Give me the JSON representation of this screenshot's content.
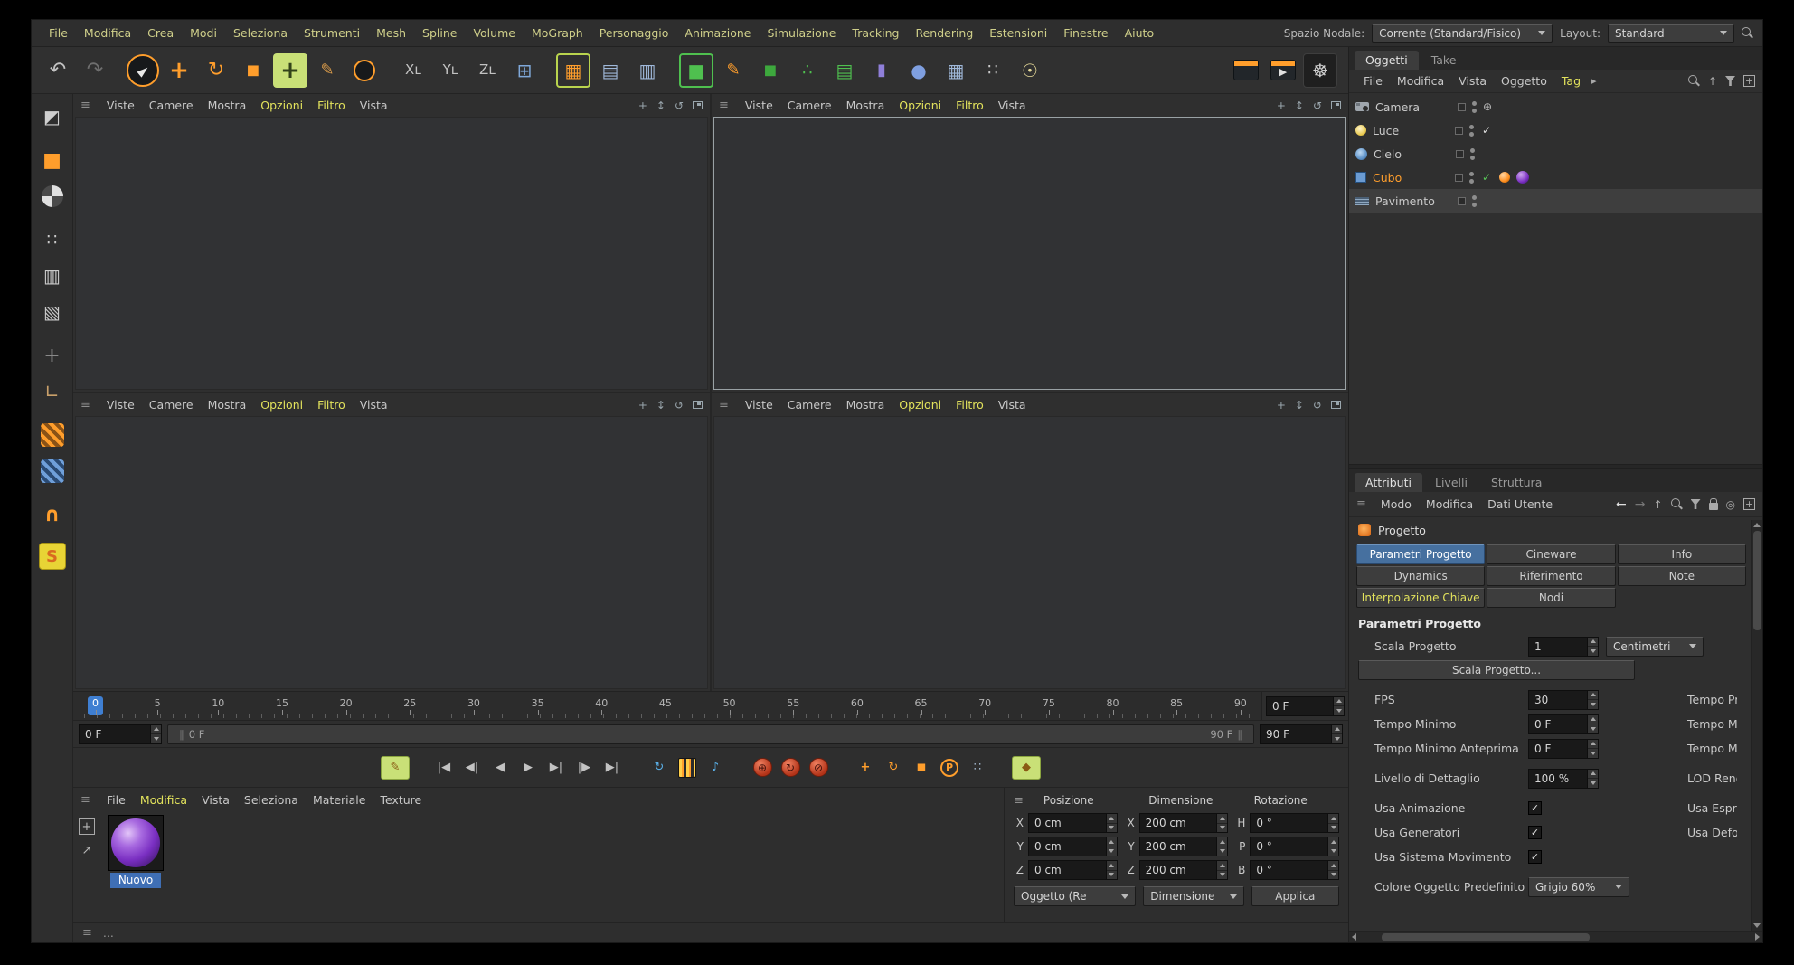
{
  "colors": {
    "accent_orange": "#ff9e2c",
    "accent_yellow": "#e2e25c",
    "selection_blue": "#46709f",
    "tool_highlight_green": "#c9e077",
    "timeline_marker_blue": "#3f7fd2",
    "material_purple": "#7a2fc2"
  },
  "icons": {
    "grip": "≡",
    "chevron_right": "▸",
    "check": "✓",
    "pan": "+",
    "zoom": "↕",
    "orbit": "↺",
    "arrow_left": "←",
    "arrow_right": "→",
    "arrow_up": "↑",
    "target": "◎",
    "plus": "+",
    "arrow_up_right": "↗",
    "range_cap": "∥"
  },
  "menubar": {
    "items": [
      {
        "label": "File"
      },
      {
        "label": "Modifica"
      },
      {
        "label": "Crea"
      },
      {
        "label": "Modi"
      },
      {
        "label": "Seleziona"
      },
      {
        "label": "Strumenti"
      },
      {
        "label": "Mesh"
      },
      {
        "label": "Spline"
      },
      {
        "label": "Volume"
      },
      {
        "label": "MoGraph"
      },
      {
        "label": "Personaggio"
      },
      {
        "label": "Animazione"
      },
      {
        "label": "Simulazione"
      },
      {
        "label": "Tracking"
      },
      {
        "label": "Rendering"
      },
      {
        "label": "Estensioni"
      },
      {
        "label": "Finestre"
      },
      {
        "label": "Aiuto"
      }
    ],
    "nodal_label": "Spazio Nodale:",
    "nodal_value": "Corrente (Standard/Fisico)",
    "layout_label": "Layout:",
    "layout_value": "Standard"
  },
  "toolbar": {
    "g1": [
      {
        "name": "undo-icon",
        "glyph": "↶",
        "fg": "#c2c2c2",
        "cls": "s22"
      },
      {
        "name": "redo-icon",
        "glyph": "↷",
        "fg": "#6e6e6e",
        "cls": "s22"
      }
    ],
    "g2": [
      {
        "name": "live-selection-tool",
        "glyph": "►",
        "fg": "#e8e8e8",
        "cls": "ring"
      },
      {
        "name": "move-tool",
        "glyph": "+",
        "fg": "#ff9e2c",
        "cls": "s26 bold"
      },
      {
        "name": "rotate-tool",
        "glyph": "↻",
        "fg": "#ff9e2c",
        "cls": "s22"
      },
      {
        "name": "scale-tool",
        "glyph": "◼",
        "fg": "#ff9e2c",
        "cls": "s18"
      },
      {
        "name": "omni-move-tool",
        "glyph": "+",
        "fg": "#33431a",
        "cls": "hl s26 bold"
      },
      {
        "name": "brush-tool",
        "glyph": "✎",
        "fg": "#d89a4a",
        "cls": "s18"
      },
      {
        "name": "circle-selection-tool",
        "glyph": "",
        "cls": "ring2"
      }
    ],
    "g3": [
      {
        "name": "x-axis-lock",
        "glyph": "Xʟ",
        "fg": "#c2c2c2",
        "cls": "s15"
      },
      {
        "name": "y-axis-lock",
        "glyph": "Yʟ",
        "fg": "#c2c2c2",
        "cls": "s15"
      },
      {
        "name": "z-axis-lock",
        "glyph": "Zʟ",
        "fg": "#c2c2c2",
        "cls": "s15"
      },
      {
        "name": "coordinate-system-toggle",
        "glyph": "⊞",
        "fg": "#7fa8d9",
        "cls": "s20"
      }
    ],
    "g4": [
      {
        "name": "render-view-button",
        "glyph": "▦",
        "fg": "#ff9e2c",
        "cls": "hlb s20"
      },
      {
        "name": "render-picture-viewer-button",
        "glyph": "▤",
        "fg": "#9fb8d9",
        "cls": "s20"
      },
      {
        "name": "render-settings-button",
        "glyph": "▥",
        "fg": "#9fb8d9",
        "cls": "s20"
      }
    ],
    "g5": [
      {
        "name": "cube-primitive-button",
        "glyph": "■",
        "fg": "#4fc04f",
        "cls": "hlg s20"
      },
      {
        "name": "spline-pen-button",
        "glyph": "✎",
        "fg": "#ff9e2c",
        "cls": "s18"
      },
      {
        "name": "generator-button",
        "glyph": "◼",
        "fg": "#3da83d",
        "cls": "s18"
      },
      {
        "name": "array-button",
        "glyph": "∴",
        "fg": "#4fc04f",
        "cls": "s18"
      },
      {
        "name": "cloner-button",
        "glyph": "▤",
        "fg": "#4fc04f",
        "cls": "s20"
      },
      {
        "name": "field-button",
        "glyph": "▮",
        "fg": "#8f7fd9",
        "cls": "s18"
      },
      {
        "name": "deformer-button",
        "glyph": "●",
        "fg": "#7f9fe0",
        "cls": "s20"
      },
      {
        "name": "floor-button",
        "glyph": "▦",
        "fg": "#9fb8d9",
        "cls": "s20"
      },
      {
        "name": "volume-button",
        "glyph": "∷",
        "fg": "#c9c9c9",
        "cls": "s18"
      },
      {
        "name": "light-button",
        "glyph": "☉",
        "fg": "#e8dc9a",
        "cls": "s20"
      }
    ],
    "g6": [
      {
        "name": "timeline-clapboard-icon",
        "glyph": "",
        "cls": "clap"
      },
      {
        "name": "render-clapboard-icon",
        "glyph": "▶",
        "fg": "#e0e0e0",
        "cls": "clap"
      },
      {
        "name": "settings-gear-icon",
        "glyph": "☸",
        "fg": "#cfcfcf",
        "cls": "darkbox s20"
      }
    ]
  },
  "mode_strip": {
    "s1": [
      {
        "name": "make-editable-icon",
        "glyph": "◩",
        "fg": "#cfcfcf",
        "cls": "s20"
      }
    ],
    "s2": [
      {
        "name": "model-mode-icon",
        "glyph": "■",
        "fg": "#ff9e2c",
        "cls": "s22"
      },
      {
        "name": "texture-mode-icon",
        "glyph": "",
        "cls": "checker"
      }
    ],
    "s3": [
      {
        "name": "points-mode-icon",
        "glyph": "∷",
        "fg": "#c9c9c9",
        "cls": "s18"
      },
      {
        "name": "edges-mode-icon",
        "glyph": "▥",
        "fg": "#c9c9c9",
        "cls": "s20"
      },
      {
        "name": "polygons-mode-icon",
        "glyph": "▧",
        "fg": "#c9c9c9",
        "cls": "s20"
      }
    ],
    "s4": [
      {
        "name": "enable-axis-icon",
        "glyph": "+",
        "fg": "#8a8a8a",
        "cls": "s22"
      },
      {
        "name": "workplane-icon",
        "glyph": "∟",
        "fg": "#c9a06a",
        "cls": "s20"
      }
    ],
    "s5": [
      {
        "name": "snap-planar-icon",
        "glyph": "",
        "cls": "hatch-o"
      },
      {
        "name": "snap-workplane-icon",
        "glyph": "",
        "cls": "hatch-b"
      }
    ],
    "s6": [
      {
        "name": "enable-snap-icon",
        "glyph": "∩",
        "fg": "#ff9e2c",
        "cls": "s22 bold"
      }
    ],
    "s7": [
      {
        "name": "snapping-icon",
        "glyph": "S",
        "fg": "#d96a1f",
        "cls": "badge s18 bold"
      }
    ]
  },
  "viewport_menu": [
    {
      "label": "Viste"
    },
    {
      "label": "Camere"
    },
    {
      "label": "Mostra"
    },
    {
      "label": "Opzioni",
      "cls": "accent"
    },
    {
      "label": "Filtro",
      "cls": "accent"
    },
    {
      "label": "Vista"
    }
  ],
  "timeline": {
    "ticks": [
      {
        "t": "0",
        "cls": "cur"
      },
      {
        "t": "5"
      },
      {
        "t": "10"
      },
      {
        "t": "15"
      },
      {
        "t": "20"
      },
      {
        "t": "25"
      },
      {
        "t": "30"
      },
      {
        "t": "35"
      },
      {
        "t": "40"
      },
      {
        "t": "45"
      },
      {
        "t": "50"
      },
      {
        "t": "55"
      },
      {
        "t": "60"
      },
      {
        "t": "65"
      },
      {
        "t": "70"
      },
      {
        "t": "75"
      },
      {
        "t": "80"
      },
      {
        "t": "85"
      },
      {
        "t": "90"
      }
    ],
    "current": "0 F",
    "start": "0 F",
    "end": "90 F",
    "bar_start": "0 F",
    "bar_end": "90 F"
  },
  "transport": {
    "t1": [
      {
        "name": "record-edit-button",
        "glyph": "✎",
        "fg": "#8a5a14",
        "cls": "hlbox s16"
      }
    ],
    "t2": [
      {
        "name": "go-start-button",
        "glyph": "|◀"
      },
      {
        "name": "prev-key-button",
        "glyph": "◀|"
      },
      {
        "name": "prev-frame-button",
        "glyph": "◀"
      },
      {
        "name": "play-button",
        "glyph": "▶",
        "cls": "s18"
      },
      {
        "name": "next-frame-button",
        "glyph": "▶|"
      },
      {
        "name": "next-key-button",
        "glyph": "|▶"
      },
      {
        "name": "go-end-button",
        "glyph": "▶|"
      }
    ],
    "t3": [
      {
        "name": "loop-button",
        "glyph": "↻",
        "fg": "#5ab0e8",
        "cls": "s20"
      },
      {
        "name": "film-button",
        "glyph": "",
        "cls": "film"
      },
      {
        "name": "sound-button",
        "glyph": "♪",
        "fg": "#5ab0e8",
        "cls": "s18"
      }
    ],
    "t4": [
      {
        "name": "record-keyframe-button",
        "glyph": "⊕",
        "cls": "red"
      },
      {
        "name": "autokey-button",
        "glyph": "↻",
        "cls": "red"
      },
      {
        "name": "keyframe-selection-button",
        "glyph": "⊘",
        "cls": "red"
      }
    ],
    "t5": [
      {
        "name": "record-position-button",
        "glyph": "+",
        "fg": "#ff9e2c",
        "cls": "s22 bold"
      },
      {
        "name": "record-rotation-button",
        "glyph": "↻",
        "fg": "#ff9e2c",
        "cls": "s18"
      },
      {
        "name": "record-scale-button",
        "glyph": "◼",
        "fg": "#ff9e2c",
        "cls": "s15"
      },
      {
        "name": "record-parameter-button",
        "glyph": "P",
        "cls": "pcirc"
      },
      {
        "name": "record-pla-button",
        "glyph": "∷",
        "fg": "#9fb3c9",
        "cls": "s16"
      }
    ],
    "t6": [
      {
        "name": "keyframe-presets-button",
        "glyph": "◆",
        "fg": "#8a5a14",
        "cls": "hlbox s14"
      }
    ]
  },
  "mat": {
    "menu": [
      {
        "label": "File"
      },
      {
        "label": "Modifica",
        "cls": "accent"
      },
      {
        "label": "Vista"
      },
      {
        "label": "Seleziona"
      },
      {
        "label": "Materiale"
      },
      {
        "label": "Texture"
      }
    ],
    "material_name": "Nuovo"
  },
  "coords": {
    "headers": [
      "Posizione",
      "Dimensione",
      "Rotazione"
    ],
    "pos": [
      {
        "l": "X",
        "v": "0 cm"
      },
      {
        "l": "Y",
        "v": "0 cm"
      },
      {
        "l": "Z",
        "v": "0 cm"
      }
    ],
    "dim": [
      {
        "l": "X",
        "v": "200 cm"
      },
      {
        "l": "Y",
        "v": "200 cm"
      },
      {
        "l": "Z",
        "v": "200 cm"
      }
    ],
    "rot": [
      {
        "l": "H",
        "v": "0 °"
      },
      {
        "l": "P",
        "v": "0 °"
      },
      {
        "l": "B",
        "v": "0 °"
      }
    ],
    "footer": {
      "obj": "Oggetto (Re",
      "dim": "Dimensione",
      "apply": "Applica"
    }
  },
  "om": {
    "tabs": [
      {
        "label": "Oggetti",
        "cls": "active",
        "n": "tab-oggetti"
      },
      {
        "label": "Take",
        "n": "tab-take"
      }
    ],
    "menu": [
      {
        "label": "File"
      },
      {
        "label": "Modifica"
      },
      {
        "label": "Vista"
      },
      {
        "label": "Oggetto"
      },
      {
        "label": "Tag",
        "cls": "accent"
      }
    ],
    "objects": [
      {
        "name": "Camera",
        "icon_cls": "oi-camera",
        "icon_name": "camera-icon",
        "extra_glyph": "⊕"
      },
      {
        "name": "Luce",
        "icon_cls": "oi-light",
        "icon_name": "light-icon",
        "check_glyph": "✓",
        "check_cls": "c-white"
      },
      {
        "name": "Cielo",
        "icon_cls": "oi-sky",
        "icon_name": "sky-icon"
      },
      {
        "name": "Cubo",
        "icon_cls": "oi-cube",
        "icon_name": "cube-icon",
        "name_cls": "selected",
        "check_glyph": "✓",
        "check_cls": "c-green",
        "has_phong": true,
        "has_material": true
      },
      {
        "name": "Pavimento",
        "icon_cls": "oi-floor",
        "icon_name": "floor-icon",
        "row_cls": "hl"
      }
    ]
  },
  "am": {
    "tabs": [
      {
        "label": "Attributi",
        "cls": "active",
        "n": "tab-attributi"
      },
      {
        "label": "Livelli",
        "n": "tab-livelli"
      },
      {
        "label": "Struttura",
        "n": "tab-struttura"
      }
    ],
    "menu": [
      {
        "label": "Modo"
      },
      {
        "label": "Modifica"
      },
      {
        "label": "Dati Utente"
      }
    ],
    "title": "Progetto",
    "buttons": [
      {
        "label": "Parametri Progetto",
        "cls": "active",
        "n": "tab-parametri-progetto"
      },
      {
        "label": "Cineware",
        "n": "tab-cineware"
      },
      {
        "label": "Info",
        "n": "tab-info"
      },
      {
        "label": "Dynamics",
        "n": "tab-dynamics"
      },
      {
        "label": "Riferimento",
        "n": "tab-riferimento"
      },
      {
        "label": "Note",
        "n": "tab-note"
      },
      {
        "label": "Interpolazione Chiave",
        "cls": "accent",
        "n": "tab-interpolazione-chiave"
      },
      {
        "label": "Nodi",
        "n": "tab-nodi"
      }
    ],
    "section": "Parametri Progetto",
    "rows": {
      "scala": {
        "label": "Scala Progetto",
        "value": "1",
        "unit": "Centimetri"
      },
      "scala_btn": "Scala Progetto...",
      "fps": {
        "label": "FPS",
        "value": "30",
        "right": "Tempo Proget"
      },
      "tmin": {
        "label": "Tempo Minimo",
        "value": "0 F",
        "right": "Tempo Massim"
      },
      "tminp": {
        "label": "Tempo Minimo Anteprima",
        "value": "0 F",
        "right": "Tempo Massim"
      },
      "lod": {
        "label": "Livello di Dettaglio",
        "value": "100 %",
        "right": "LOD Renderin"
      },
      "anim": {
        "label": "Usa Animazione",
        "right": "Usa Espressio"
      },
      "gen": {
        "label": "Usa Generatori",
        "right": "Usa Deformat"
      },
      "mov": {
        "label": "Usa Sistema Movimento"
      },
      "color": {
        "label": "Colore Oggetto Predefinito",
        "value": "Grigio 60%"
      }
    }
  },
  "status": {
    "text": "…"
  }
}
